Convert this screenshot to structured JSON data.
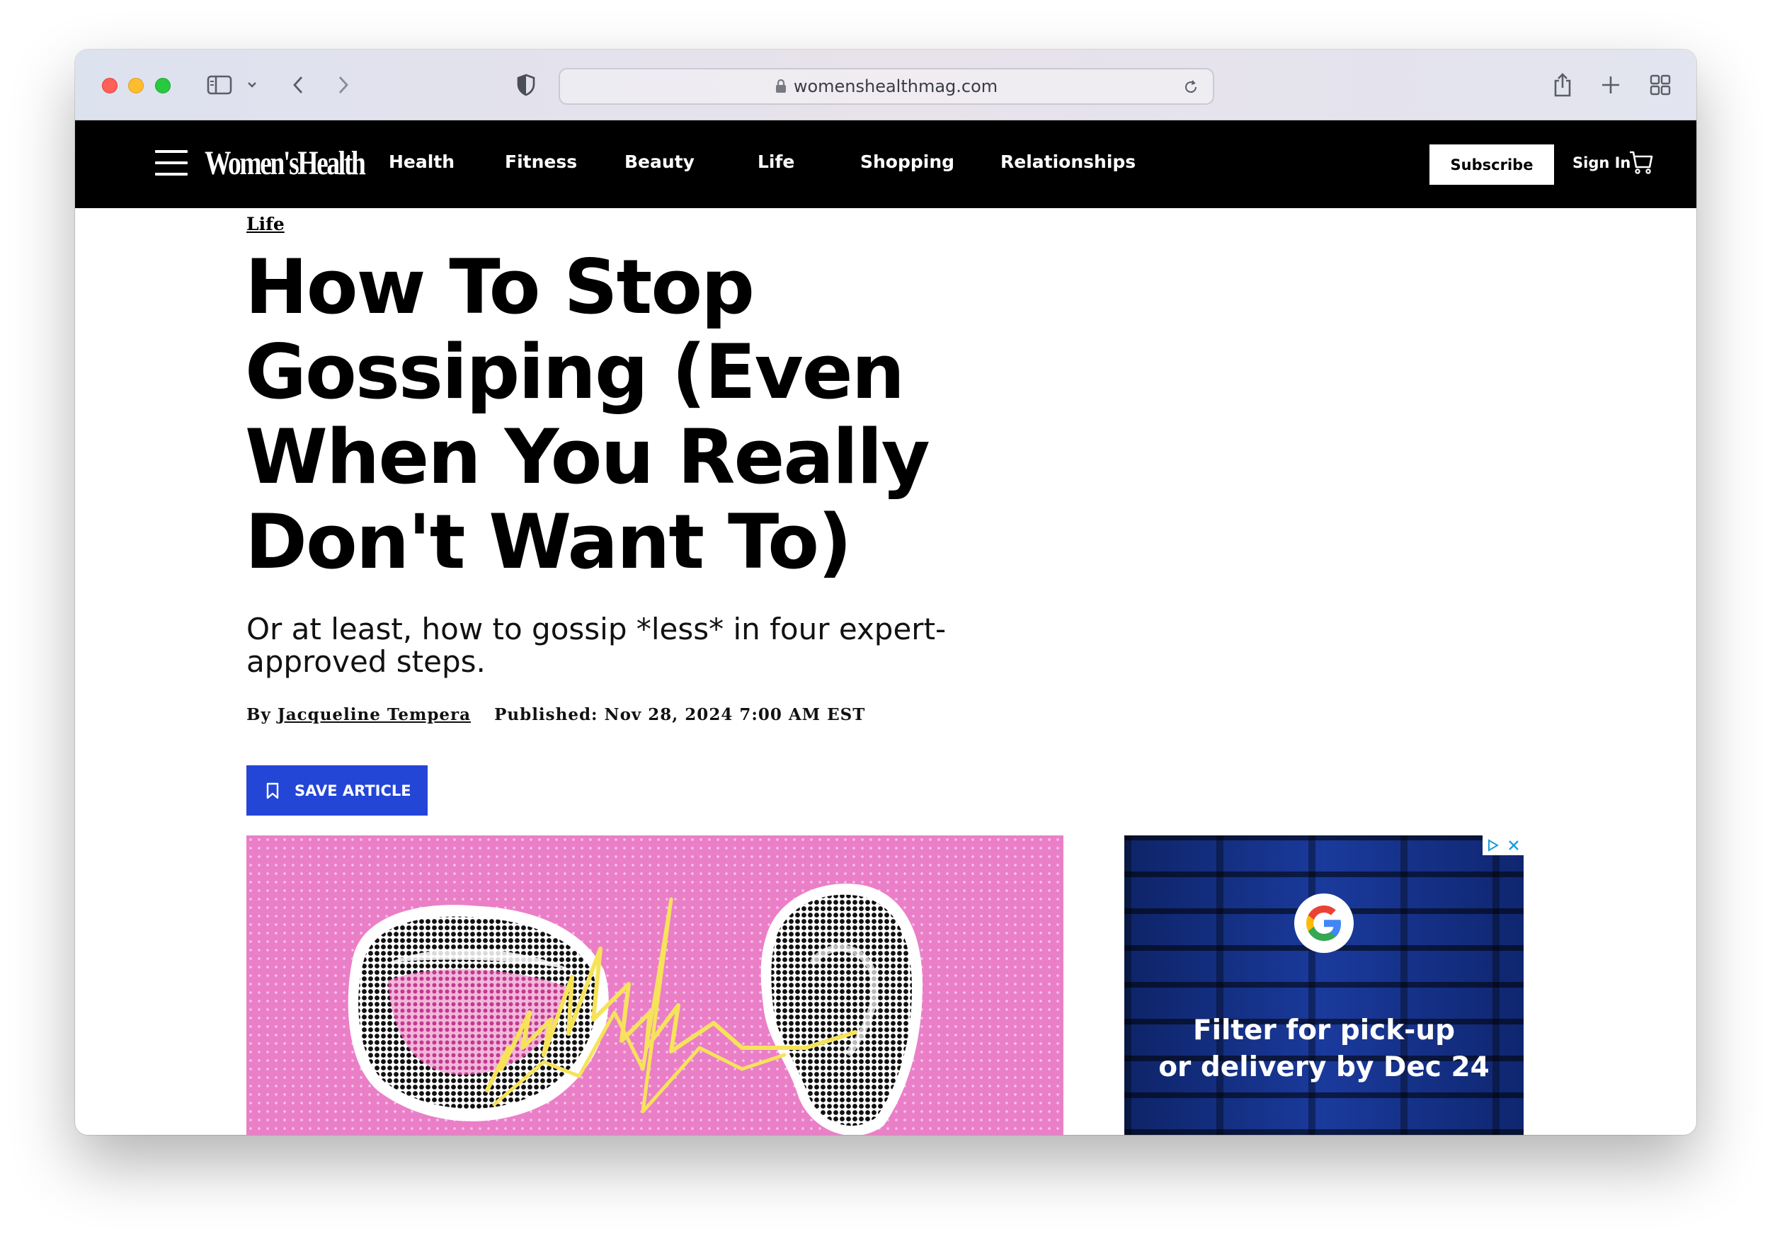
{
  "browser": {
    "url": "womenshealthmag.com"
  },
  "site": {
    "logo": "Women'sHealth",
    "nav": [
      "Health",
      "Fitness",
      "Beauty",
      "Life",
      "Shopping",
      "Relationships"
    ],
    "subscribe_label": "Subscribe",
    "signin_label": "Sign In"
  },
  "article": {
    "category": "Life",
    "headline": "How To Stop Gossiping (Even When You Really Don't Want To)",
    "dek": "Or at least, how to gossip *less* in four expert-approved steps.",
    "byline_prefix": "By",
    "author": "Jacqueline Tempera",
    "published": "Published: Nov 28, 2024 7:00 AM EST",
    "save_label": "SAVE ARTICLE"
  },
  "ad": {
    "line1": "Filter for pick-up",
    "line2": "or delivery by Dec 24"
  },
  "colors": {
    "nav_bg": "#000000",
    "save_button": "#2446d6",
    "hero_bg": "#ea7fc8",
    "ad_bg": "#112a7a"
  }
}
